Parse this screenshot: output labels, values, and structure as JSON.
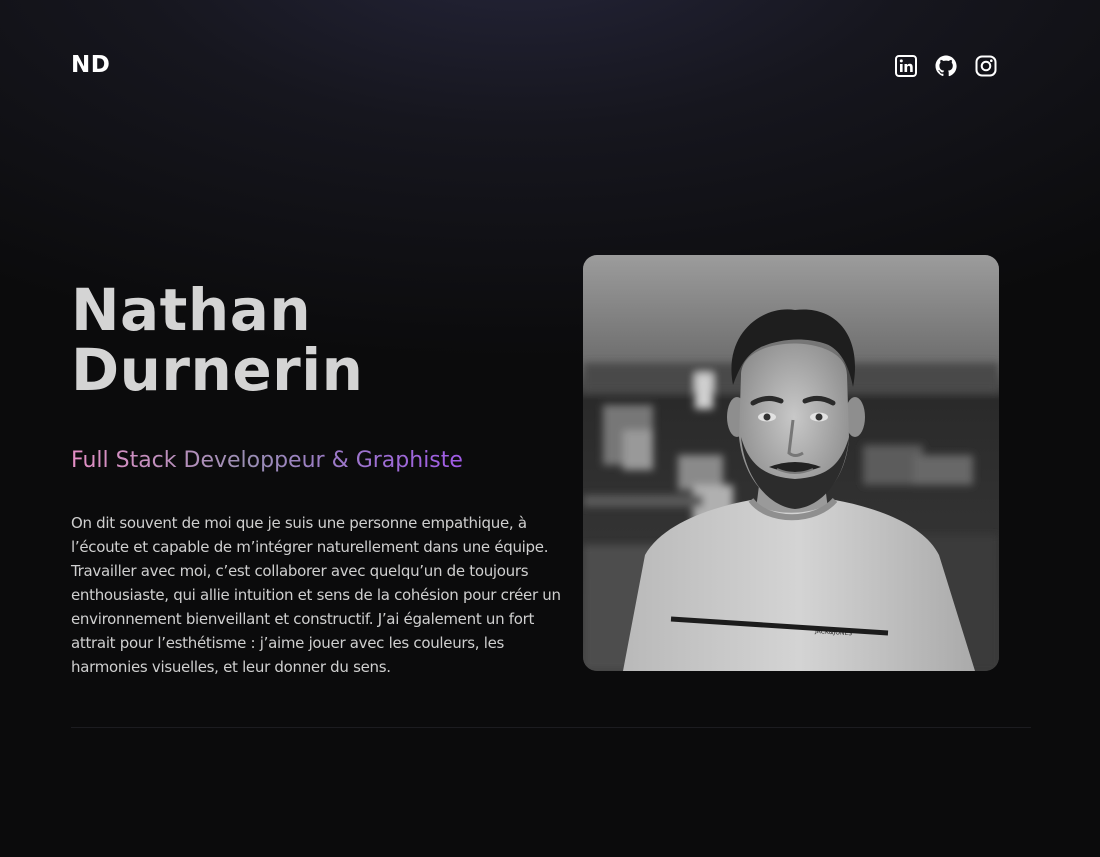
{
  "header": {
    "logo": "ND",
    "socials": [
      {
        "icon": "linkedin-icon",
        "label": "LinkedIn"
      },
      {
        "icon": "github-icon",
        "label": "GitHub"
      },
      {
        "icon": "instagram-icon",
        "label": "Instagram"
      }
    ]
  },
  "hero": {
    "first_name": "Nathan",
    "last_name": "Durnerin",
    "role": "Full Stack Developpeur & Graphiste",
    "bio": "On dit souvent de moi que je suis une personne empathique, à l’écoute et capable de m’intégrer naturellement dans une équipe. Travailler avec moi, c’est collaborer avec quelqu’un de toujours enthousiaste, qui allie intuition et sens de la cohésion pour créer un environnement bienveillant et constructif. J’ai également un fort attrait pour l’esthétisme : j’aime jouer avec les couleurs, les harmonies visuelles, et leur donner du sens.",
    "photo_shirt_text": "JACK&JONES"
  },
  "colors": {
    "background": "#0b0b0c",
    "role_gradient": [
      "#e58fc6",
      "#9a8fb4",
      "#a05ae6"
    ]
  }
}
